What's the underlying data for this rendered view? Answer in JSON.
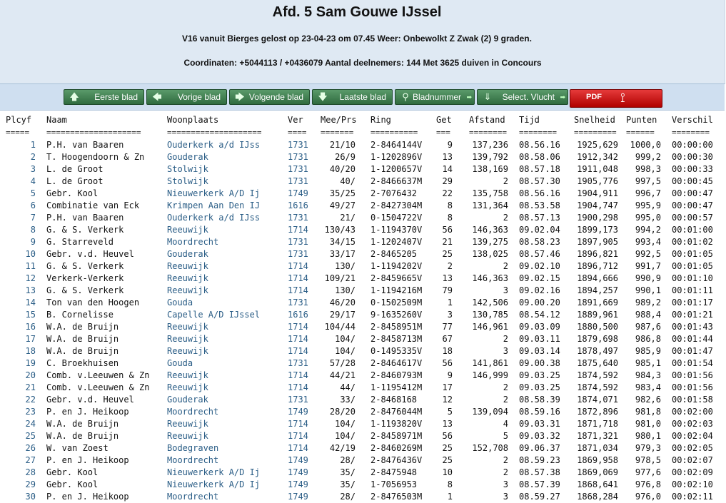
{
  "header": {
    "title": "Afd. 5 Sam Gouwe IJssel",
    "line1": "V16 vanuit Bierges gelost op 23-04-23 om 07.45 Weer: Onbewolkt Z Zwak (2) 9 graden.",
    "line2": "Coordinaten: +5044113 / +0436079 Aantal deelnemers: 144 Met 3625 duiven in Concours"
  },
  "toolbar": {
    "buttons": [
      {
        "label": "Eerste blad",
        "icon": "arrow-up-icon"
      },
      {
        "label": "Vorige blad",
        "icon": "arrow-left-icon"
      },
      {
        "label": "Volgende blad",
        "icon": "arrow-right-icon"
      },
      {
        "label": "Laatste blad",
        "icon": "arrow-down-icon"
      },
      {
        "label": "Bladnummer",
        "icon": "search-icon"
      },
      {
        "label": "Select. Vlucht",
        "icon": "download-icon"
      }
    ],
    "pdf_label": "PDF",
    "pdf_icon": "acrobat-icon"
  },
  "table": {
    "columns": [
      "Plcyf",
      "Naam",
      "Woonplaats",
      "Ver",
      "Mee/Prs",
      "Ring",
      "Get",
      "Afstand",
      "Tijd",
      "Snelheid",
      "Punten",
      "Verschil"
    ],
    "separators": [
      "=====",
      "====================",
      "====================",
      "====",
      "=======",
      "==========",
      "===",
      "========",
      "========",
      "=========",
      "======",
      "========"
    ],
    "rows": [
      [
        "1",
        "P.H. van Baaren",
        "Ouderkerk a/d IJss",
        "1731",
        "21/10",
        "2-8464144V",
        "9",
        "137,236",
        "08.56.16",
        "1925,629",
        "1000,0",
        "00:00:00"
      ],
      [
        "2",
        "T. Hoogendoorn & Zn",
        "Gouderak",
        "1731",
        "26/9",
        "1-1202896V",
        "13",
        "139,792",
        "08.58.06",
        "1912,342",
        "999,2",
        "00:00:30"
      ],
      [
        "3",
        "L. de Groot",
        "Stolwijk",
        "1731",
        "40/20",
        "1-1200657V",
        "14",
        "138,169",
        "08.57.18",
        "1911,048",
        "998,3",
        "00:00:33"
      ],
      [
        "4",
        "L. de Groot",
        "Stolwijk",
        "1731",
        "40/",
        "2-8466637M",
        "29",
        "2",
        "08.57.30",
        "1905,776",
        "997,5",
        "00:00:45"
      ],
      [
        "5",
        "Gebr. Kool",
        "Nieuwerkerk A/D Ij",
        "1749",
        "35/25",
        "2-7076432",
        "22",
        "135,758",
        "08.56.16",
        "1904,911",
        "996,7",
        "00:00:47"
      ],
      [
        "6",
        "Combinatie van Eck",
        "Krimpen Aan Den IJ",
        "1616",
        "49/27",
        "2-8427304M",
        "8",
        "131,364",
        "08.53.58",
        "1904,747",
        "995,9",
        "00:00:47"
      ],
      [
        "7",
        "P.H. van Baaren",
        "Ouderkerk a/d IJss",
        "1731",
        "21/",
        "0-1504722V",
        "8",
        "2",
        "08.57.13",
        "1900,298",
        "995,0",
        "00:00:57"
      ],
      [
        "8",
        "G. & S. Verkerk",
        "Reeuwijk",
        "1714",
        "130/43",
        "1-1194370V",
        "56",
        "146,363",
        "09.02.04",
        "1899,173",
        "994,2",
        "00:01:00"
      ],
      [
        "9",
        "G. Starreveld",
        "Moordrecht",
        "1731",
        "34/15",
        "1-1202407V",
        "21",
        "139,275",
        "08.58.23",
        "1897,905",
        "993,4",
        "00:01:02"
      ],
      [
        "10",
        "Gebr. v.d. Heuvel",
        "Gouderak",
        "1731",
        "33/17",
        "2-8465205",
        "25",
        "138,025",
        "08.57.46",
        "1896,821",
        "992,5",
        "00:01:05"
      ],
      [
        "11",
        "G. & S. Verkerk",
        "Reeuwijk",
        "1714",
        "130/",
        "1-1194202V",
        "2",
        "2",
        "09.02.10",
        "1896,712",
        "991,7",
        "00:01:05"
      ],
      [
        "12",
        "Verkerk-Verkerk",
        "Reeuwijk",
        "1714",
        "109/21",
        "2-8459665V",
        "13",
        "146,363",
        "09.02.15",
        "1894,666",
        "990,9",
        "00:01:10"
      ],
      [
        "13",
        "G. & S. Verkerk",
        "Reeuwijk",
        "1714",
        "130/",
        "1-1194216M",
        "79",
        "3",
        "09.02.16",
        "1894,257",
        "990,1",
        "00:01:11"
      ],
      [
        "14",
        "Ton van den Hoogen",
        "Gouda",
        "1731",
        "46/20",
        "0-1502509M",
        "1",
        "142,506",
        "09.00.20",
        "1891,669",
        "989,2",
        "00:01:17"
      ],
      [
        "15",
        "B. Cornelisse",
        "Capelle A/D IJssel",
        "1616",
        "29/17",
        "9-1635260V",
        "3",
        "130,785",
        "08.54.12",
        "1889,961",
        "988,4",
        "00:01:21"
      ],
      [
        "16",
        "W.A. de Bruijn",
        "Reeuwijk",
        "1714",
        "104/44",
        "2-8458951M",
        "77",
        "146,961",
        "09.03.09",
        "1880,500",
        "987,6",
        "00:01:43"
      ],
      [
        "17",
        "W.A. de Bruijn",
        "Reeuwijk",
        "1714",
        "104/",
        "2-8458713M",
        "67",
        "2",
        "09.03.11",
        "1879,698",
        "986,8",
        "00:01:44"
      ],
      [
        "18",
        "W.A. de Bruijn",
        "Reeuwijk",
        "1714",
        "104/",
        "0-1495335V",
        "18",
        "3",
        "09.03.14",
        "1878,497",
        "985,9",
        "00:01:47"
      ],
      [
        "19",
        "C. Broekhuisen",
        "Gouda",
        "1731",
        "57/28",
        "2-8464617V",
        "56",
        "141,861",
        "09.00.38",
        "1875,640",
        "985,1",
        "00:01:54"
      ],
      [
        "20",
        "Comb. v.Leeuwen & Zn",
        "Reeuwijk",
        "1714",
        "44/21",
        "2-8460793M",
        "9",
        "146,999",
        "09.03.25",
        "1874,592",
        "984,3",
        "00:01:56"
      ],
      [
        "21",
        "Comb. v.Leeuwen & Zn",
        "Reeuwijk",
        "1714",
        "44/",
        "1-1195412M",
        "17",
        "2",
        "09.03.25",
        "1874,592",
        "983,4",
        "00:01:56"
      ],
      [
        "22",
        "Gebr. v.d. Heuvel",
        "Gouderak",
        "1731",
        "33/",
        "2-8468168",
        "12",
        "2",
        "08.58.39",
        "1874,071",
        "982,6",
        "00:01:58"
      ],
      [
        "23",
        "P. en J. Heikoop",
        "Moordrecht",
        "1749",
        "28/20",
        "2-8476044M",
        "5",
        "139,094",
        "08.59.16",
        "1872,896",
        "981,8",
        "00:02:00"
      ],
      [
        "24",
        "W.A. de Bruijn",
        "Reeuwijk",
        "1714",
        "104/",
        "1-1193820V",
        "13",
        "4",
        "09.03.31",
        "1871,718",
        "981,0",
        "00:02:03"
      ],
      [
        "25",
        "W.A. de Bruijn",
        "Reeuwijk",
        "1714",
        "104/",
        "2-8458971M",
        "56",
        "5",
        "09.03.32",
        "1871,321",
        "980,1",
        "00:02:04"
      ],
      [
        "26",
        "W. van Zoest",
        "Bodegraven",
        "1714",
        "42/19",
        "2-8460269M",
        "25",
        "152,708",
        "09.06.37",
        "1871,034",
        "979,3",
        "00:02:05"
      ],
      [
        "27",
        "P. en J. Heikoop",
        "Moordrecht",
        "1749",
        "28/",
        "2-8476436V",
        "25",
        "2",
        "08.59.23",
        "1869,958",
        "978,5",
        "00:02:07"
      ],
      [
        "28",
        "Gebr. Kool",
        "Nieuwerkerk A/D Ij",
        "1749",
        "35/",
        "2-8475948",
        "10",
        "2",
        "08.57.38",
        "1869,069",
        "977,6",
        "00:02:09"
      ],
      [
        "29",
        "Gebr. Kool",
        "Nieuwerkerk A/D Ij",
        "1749",
        "35/",
        "1-7056953",
        "8",
        "3",
        "08.57.39",
        "1868,641",
        "976,8",
        "00:02:10"
      ],
      [
        "30",
        "P. en J. Heikoop",
        "Moordrecht",
        "1749",
        "28/",
        "2-8476503M",
        "1",
        "3",
        "08.59.27",
        "1868,284",
        "976,0",
        "00:02:11"
      ]
    ]
  },
  "colors": {
    "header_bg": "#dfe9f3",
    "toolbar_bg": "#cfdff0",
    "button_green": "#2f6b3f",
    "pdf_red": "#b00000",
    "link_blue": "#2a5d86"
  }
}
